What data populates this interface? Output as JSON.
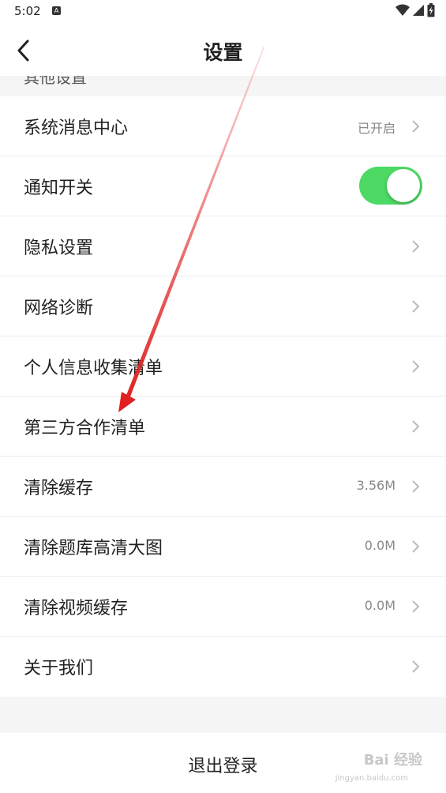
{
  "status_bar": {
    "time": "5:02",
    "notif_icon": "A"
  },
  "nav": {
    "title": "设置",
    "back_icon": "chevron-left-icon"
  },
  "section": {
    "label": "其他设置"
  },
  "items": [
    {
      "label": "系统消息中心",
      "value": "已开启"
    },
    {
      "label": "通知开关",
      "toggle_on": true
    },
    {
      "label": "隐私设置",
      "value": ""
    },
    {
      "label": "网络诊断",
      "value": ""
    },
    {
      "label": "个人信息收集清单",
      "value": ""
    },
    {
      "label": "第三方合作清单",
      "value": ""
    },
    {
      "label": "清除缓存",
      "value": "3.56M"
    },
    {
      "label": "清除题库高清大图",
      "value": "0.0M"
    },
    {
      "label": "清除视频缓存",
      "value": "0.0M"
    },
    {
      "label": "关于我们",
      "value": ""
    }
  ],
  "logout": {
    "label": "退出登录"
  },
  "watermark": {
    "text": "Bai 经验",
    "sub": "jingyan.baidu.com"
  },
  "colors": {
    "toggle_on": "#4cd964",
    "annotation_arrow": "#e02020"
  }
}
